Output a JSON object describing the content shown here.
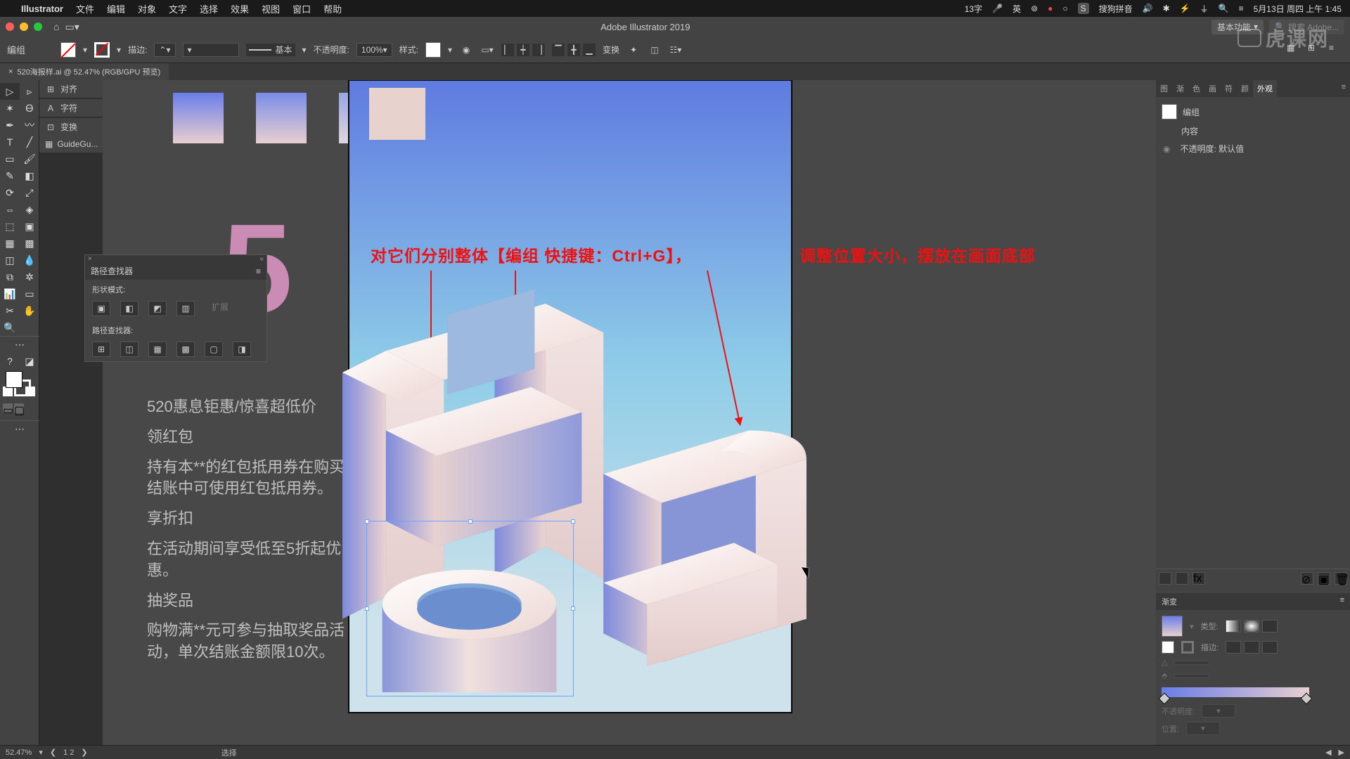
{
  "mac_menu": {
    "app": "Illustrator",
    "items": [
      "文件",
      "编辑",
      "对象",
      "文字",
      "选择",
      "效果",
      "视图",
      "窗口",
      "帮助"
    ],
    "right": {
      "input": "13字",
      "mic": "🎤",
      "ime": "英",
      "obs": "⊚",
      "rec": "●",
      "wechat": "○",
      "sogou_icon": "S",
      "sogou": "搜狗拼音",
      "sound": "🔊",
      "bt": "✱",
      "battery": "⚡",
      "wifi": "⏚",
      "spotlight": "🔍",
      "cc": "≡",
      "date": "5月13日 周四 上午 1:45"
    }
  },
  "titlebar": {
    "title": "Adobe Illustrator 2019",
    "workspace": "基本功能",
    "search_ph": "搜索 Adobe..."
  },
  "control": {
    "selection": "编组",
    "stroke_label": "描边:",
    "stroke_dd": "",
    "stroke_style": "基本",
    "opacity_label": "不透明度:",
    "opacity_val": "100%",
    "style_label": "样式:",
    "transform_label": "变换"
  },
  "doc_tab": {
    "name": "520海报样.ai @ 52.47% (RGB/GPU 预览)"
  },
  "side_items": [
    "对齐",
    "字符",
    "变换",
    "GuideGu..."
  ],
  "pathfinder": {
    "title": "路径查找器",
    "mode": "形状模式:",
    "pf_label": "路径查找器:",
    "expand": "扩展"
  },
  "canvas": {
    "annotation": "对它们分别整体【编组 快捷键：Ctrl+G】，",
    "annotation2": "调整位置大小，摆放在画面底部",
    "big5": "5",
    "copy": [
      "520惠息钜惠/惊喜超低价",
      "领红包",
      "持有本**的红包抵用券在购买结账中可使用红包抵用券。",
      "享折扣",
      "在活动期间享受低至5折起优惠。",
      "抽奖品",
      "购物满**元可参与抽取奖品活动，单次结账金额限10次。"
    ]
  },
  "right_panel": {
    "tabs": [
      "图",
      "渐",
      "色",
      "画",
      "符",
      "颜",
      "外观"
    ],
    "rows": {
      "group": "编组",
      "contents": "内容",
      "opacity": "不透明度: 默认值"
    }
  },
  "gradient": {
    "title": "渐变",
    "type_label": "类型:",
    "stroke_label": "描边:",
    "angle_label": "",
    "opacity_label": "不透明度:",
    "pos_label": "位置:"
  },
  "status": {
    "zoom": "52.47%",
    "nav": "1  2",
    "sel": "选择"
  }
}
